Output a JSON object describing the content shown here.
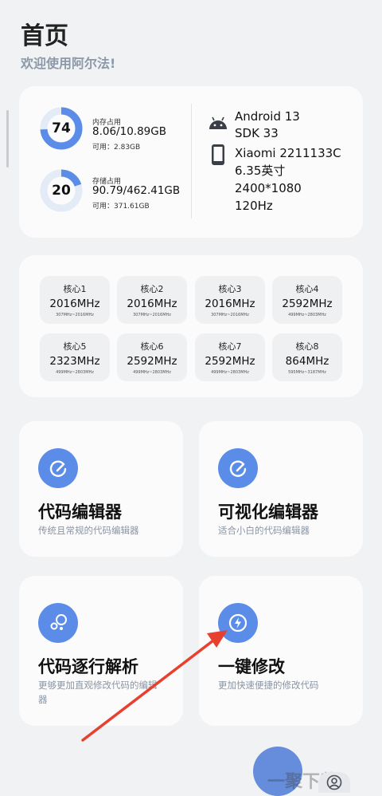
{
  "header": {
    "title": "首页",
    "subtitle": "欢迎使用阿尔法!"
  },
  "memory": {
    "percent": 74,
    "label": "内存占用",
    "value": "8.06/10.89GB",
    "available": "可用：2.83GB"
  },
  "storage": {
    "percent": 20,
    "label": "存储占用",
    "value": "90.79/462.41GB",
    "available": "可用：371.61GB"
  },
  "device": {
    "android": "Android 13",
    "sdk": "SDK 33",
    "model": "Xiaomi 2211133C",
    "screen_size": "6.35英寸",
    "resolution": "2400*1080",
    "refresh": "120Hz"
  },
  "cores": [
    {
      "name": "核心1",
      "freq": "2016MHz",
      "range": "307MHz~2016MHz"
    },
    {
      "name": "核心2",
      "freq": "2016MHz",
      "range": "307MHz~2016MHz"
    },
    {
      "name": "核心3",
      "freq": "2016MHz",
      "range": "307MHz~2016MHz"
    },
    {
      "name": "核心4",
      "freq": "2592MHz",
      "range": "499MHz~2803MHz"
    },
    {
      "name": "核心5",
      "freq": "2323MHz",
      "range": "499MHz~2803MHz"
    },
    {
      "name": "核心6",
      "freq": "2592MHz",
      "range": "499MHz~2803MHz"
    },
    {
      "name": "核心7",
      "freq": "2592MHz",
      "range": "499MHz~2803MHz"
    },
    {
      "name": "核心8",
      "freq": "864MHz",
      "range": "595MHz~3187MHz"
    }
  ],
  "features": [
    {
      "title": "代码编辑器",
      "desc": "传统且常规的代码编辑器",
      "icon": "pen-icon"
    },
    {
      "title": "可视化编辑器",
      "desc": "适合小白的代码编辑器",
      "icon": "pen-icon"
    },
    {
      "title": "代码逐行解析",
      "desc": "更够更加直观修改代码的编辑器",
      "icon": "bubbles-icon"
    },
    {
      "title": "一键修改",
      "desc": "更加快速便捷的修改代码",
      "icon": "bolt-icon"
    }
  ],
  "watermark": "一聚下载",
  "colors": {
    "accent": "#5b8de8",
    "ring_track": "#e3ebf7",
    "arrow": "#e8402f"
  }
}
